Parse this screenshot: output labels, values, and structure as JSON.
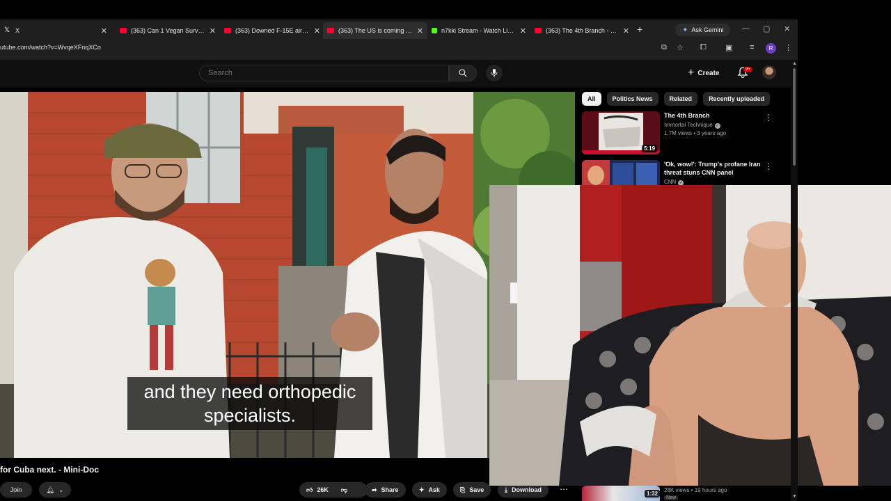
{
  "browser": {
    "tabs": [
      {
        "label": "X",
        "favicon": "x-logo-icon",
        "active": false
      },
      {
        "label": "(363) Can 1 Vegan Survive 2...",
        "favicon": "youtube-logo-icon",
        "active": false
      },
      {
        "label": "(363) Downed F-15E airman...",
        "favicon": "youtube-logo-icon",
        "active": false
      },
      {
        "label": "(363) The US is coming for C...",
        "favicon": "youtube-logo-icon",
        "active": true
      },
      {
        "label": "n7kki Stream - Watch Live o...",
        "favicon": "kick-logo-icon",
        "active": false
      },
      {
        "label": "(363) The 4th Branch - YouTu...",
        "favicon": "youtube-logo-icon",
        "active": false
      }
    ],
    "gemini_label": "Ask Gemini",
    "url": "utube.com/watch?v=WvqeXFnqXCo",
    "profile_initial": "R"
  },
  "youtube": {
    "search_placeholder": "Search",
    "create_label": "Create",
    "notification_count": "9+",
    "chips": [
      "All",
      "Politics News",
      "Related",
      "Recently uploaded"
    ],
    "active_chip": "All",
    "recommendations": [
      {
        "title": "The 4th Branch",
        "channel": "Immortal Technique",
        "meta": "1.7M views • 3 years ago",
        "duration": "5:19"
      },
      {
        "title": "'Ok, wow!': Trump's profane Iran threat stuns CNN panel",
        "channel": "CNN",
        "meta": "",
        "duration": ""
      }
    ],
    "bottom_recommendation": {
      "meta": "28K views • 19 hours ago",
      "badge": "New",
      "duration": "1:32"
    },
    "video": {
      "caption_line1": "and they need orthopedic",
      "caption_line2": "specialists.",
      "title": "for Cuba next. - Mini-Doc"
    },
    "actions": {
      "join": "Join",
      "likes": "26K",
      "share": "Share",
      "ask": "Ask",
      "save": "Save",
      "download": "Download"
    }
  }
}
